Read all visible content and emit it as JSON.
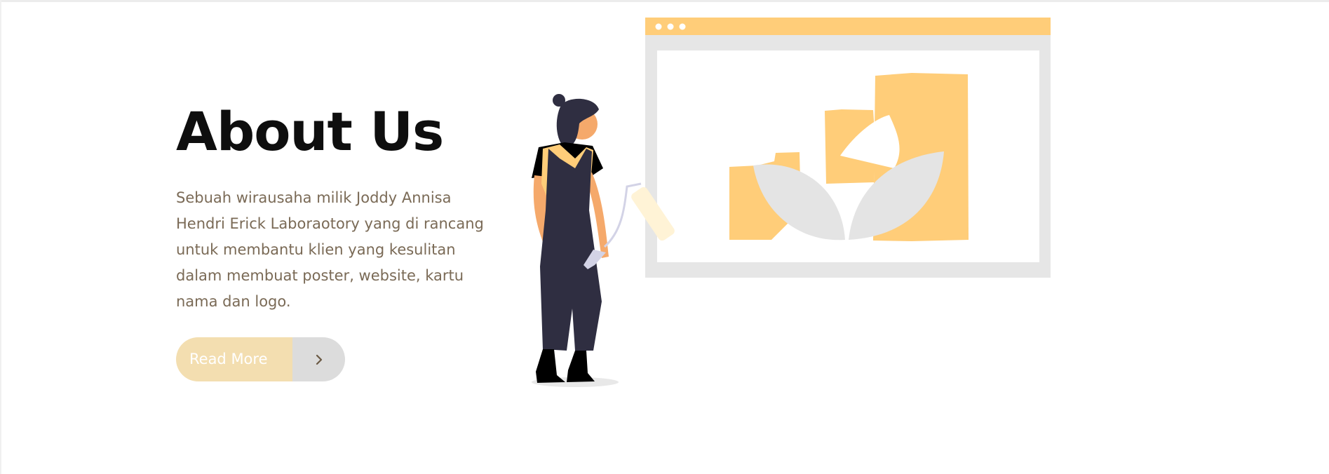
{
  "about": {
    "title": "About Us",
    "description": "Sebuah wirausaha milik Joddy Annisa Hendri Erick Laboraotory yang di rancang untuk membantu klien yang kesulitan dalam membuat poster, website, kartu nama dan logo.",
    "read_more_label": "Read More",
    "read_more_icon": "chevron-right-icon"
  },
  "colors": {
    "heading": "#0e0e0e",
    "body_text": "#7a6a56",
    "accent": "#ffcd79",
    "button_primary": "#f3deb0",
    "button_secondary": "#dcdcdc",
    "figure_dark": "#2f2e41"
  }
}
